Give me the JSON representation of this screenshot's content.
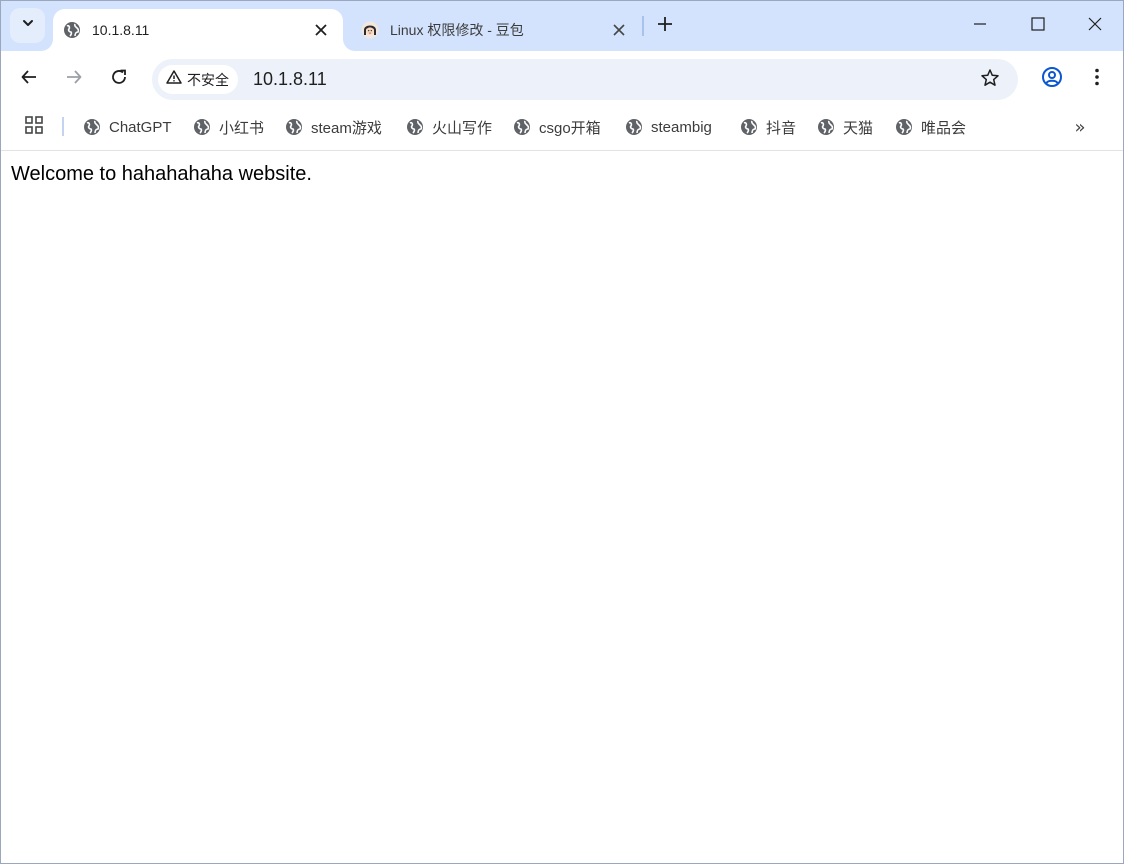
{
  "tabs": [
    {
      "title": "10.1.8.11",
      "favicon": "globe-icon",
      "active": true
    },
    {
      "title": "Linux 权限修改 - 豆包",
      "favicon": "doubao-avatar-icon",
      "active": false
    }
  ],
  "toolbar": {
    "security_label": "不安全",
    "url": "10.1.8.11"
  },
  "bookmarks": [
    {
      "label": "ChatGPT"
    },
    {
      "label": "小红书"
    },
    {
      "label": "steam游戏"
    },
    {
      "label": "火山写作"
    },
    {
      "label": "csgo开箱"
    },
    {
      "label": "steambig"
    },
    {
      "label": "抖音"
    },
    {
      "label": "天猫"
    },
    {
      "label": "唯品会"
    }
  ],
  "bookmarks_overflow": "»",
  "page": {
    "text": "Welcome to hahahahaha website."
  },
  "colors": {
    "tabstrip_bg": "#d3e3fd",
    "omnibox_bg": "#edf2fa",
    "accent_blue": "#0b57d0"
  }
}
